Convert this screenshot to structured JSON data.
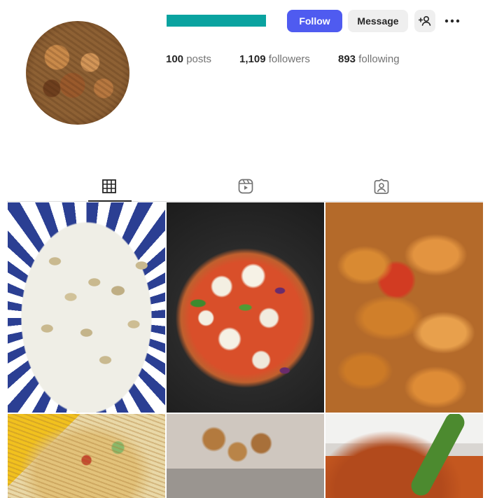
{
  "profile": {
    "follow_label": "Follow",
    "message_label": "Message",
    "stats": {
      "posts_count": "100",
      "posts_label": "posts",
      "followers_count": "1,109",
      "followers_label": "followers",
      "following_count": "893",
      "following_label": "following"
    }
  },
  "icons": {
    "add_user": "add-user-icon",
    "more": "more-options-icon",
    "grid_tab": "grid-icon",
    "reels_tab": "reels-icon",
    "tagged_tab": "tagged-icon"
  },
  "colors": {
    "follow_button": "#4f5bf0",
    "secondary_button": "#efefef",
    "username_placeholder": "#0aa3a0"
  },
  "tabs": {
    "active": "grid"
  },
  "grid": {
    "posts": [
      {
        "subject": "kheer"
      },
      {
        "subject": "pizza"
      },
      {
        "subject": "fried chicken"
      },
      {
        "subject": "noodles"
      },
      {
        "subject": "snacks"
      },
      {
        "subject": "curry"
      }
    ]
  }
}
